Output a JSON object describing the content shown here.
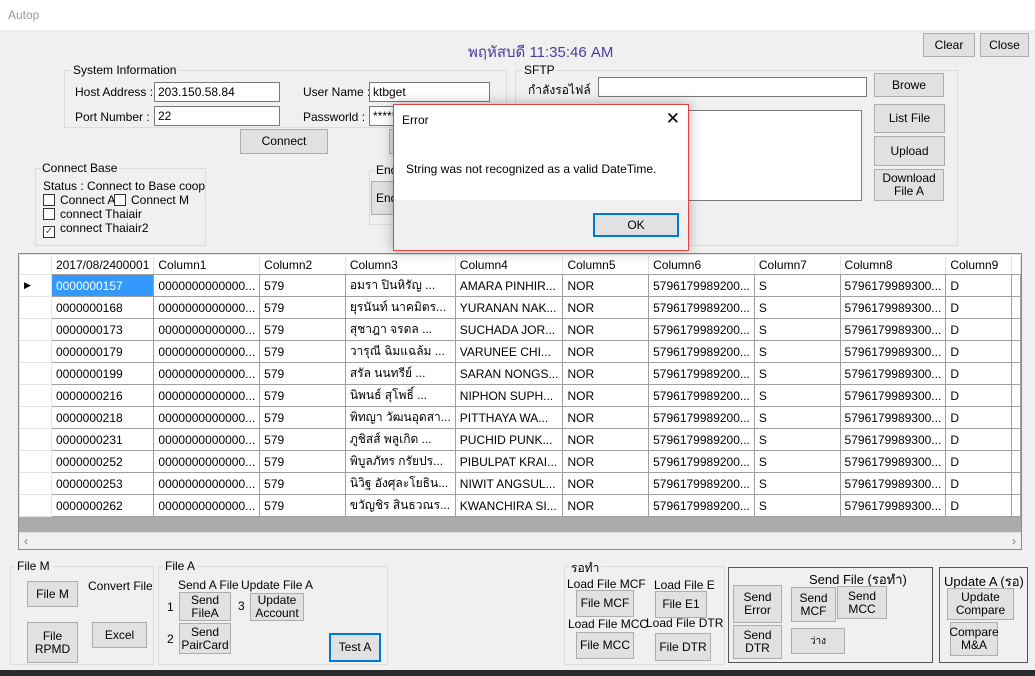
{
  "window": {
    "title": "Autop",
    "datetime": "พฤหัสบดี 11:35:46 AM",
    "clear": "Clear",
    "close": "Close"
  },
  "system_info": {
    "title": "System Information",
    "host_label": "Host Address :",
    "host_value": "203.150.58.84",
    "port_label": "Port Number :",
    "port_value": "22",
    "user_label": "User Name :",
    "user_value": "ktbget",
    "password_label": "Passworld :",
    "password_value": "******",
    "connect": "Connect"
  },
  "connect_base": {
    "title": "Connect Base",
    "status": "Status : Connect to Base coop_sa",
    "connect_a": "Connect A",
    "connect_m": "Connect M",
    "thaiair": "connect Thaiair",
    "thaiair2": "connect Thaiair2"
  },
  "end_group": {
    "title": "End",
    "button": "End"
  },
  "sftp": {
    "title": "SFTP",
    "waiting_label": "กำลังรอไฟล์",
    "waiting_value": "",
    "log_value": "",
    "browse": "Browe",
    "list": "List File",
    "upload": "Upload",
    "download": "Download File A"
  },
  "dialog": {
    "title": "Error",
    "message": "String was not recognized as a valid DateTime.",
    "ok": "OK"
  },
  "grid": {
    "columns": [
      "2017/08/2400001",
      "Column1",
      "Column2",
      "Column3",
      "Column4",
      "Column5",
      "Column6",
      "Column7",
      "Column8",
      "Column9"
    ],
    "rows": [
      [
        "0000000157",
        "0000000000000...",
        "579",
        "อมรา ปินหิรัญ    ...",
        "AMARA PINHIR...",
        "NOR",
        "5796179989200...",
        "S",
        "5796179989300...",
        "D"
      ],
      [
        "0000000168",
        "0000000000000...",
        "579",
        "ยุรนันท์ นาคมิตร...",
        "YURANAN NAK...",
        "NOR",
        "5796179989200...",
        "S",
        "5796179989300...",
        "D"
      ],
      [
        "0000000173",
        "0000000000000...",
        "579",
        "สุชาฎา จรดล     ...",
        "SUCHADA JOR...",
        "NOR",
        "5796179989200...",
        "S",
        "5796179989300...",
        "D"
      ],
      [
        "0000000179",
        "0000000000000...",
        "579",
        "วารุณี ฉิมแฉล้ม ...",
        "VARUNEE CHI...",
        "NOR",
        "5796179989200...",
        "S",
        "5796179989300...",
        "D"
      ],
      [
        "0000000199",
        "0000000000000...",
        "579",
        "สรัล นนทรีย์    ...",
        "SARAN NONGS...",
        "NOR",
        "5796179989200...",
        "S",
        "5796179989300...",
        "D"
      ],
      [
        "0000000216",
        "0000000000000...",
        "579",
        "นิพนธ์ สุโพธิ์   ...",
        "NIPHON SUPH...",
        "NOR",
        "5796179989200...",
        "S",
        "5796179989300...",
        "D"
      ],
      [
        "0000000218",
        "0000000000000...",
        "579",
        "พิทญา วัฒนอุดสา...",
        "PITTHAYA WA...",
        "NOR",
        "5796179989200...",
        "S",
        "5796179989300...",
        "D"
      ],
      [
        "0000000231",
        "0000000000000...",
        "579",
        "ภูชิสส์ พลูเกิด   ...",
        "PUCHID PUNK...",
        "NOR",
        "5796179989200...",
        "S",
        "5796179989300...",
        "D"
      ],
      [
        "0000000252",
        "0000000000000...",
        "579",
        "พิบูลภัทร กรัยปร...",
        "PIBULPAT KRAI...",
        "NOR",
        "5796179989200...",
        "S",
        "5796179989300...",
        "D"
      ],
      [
        "0000000253",
        "0000000000000...",
        "579",
        "นิวิฐ อังศุละโยธิน...",
        "NIWIT ANGSUL...",
        "NOR",
        "5796179989200...",
        "S",
        "5796179989300...",
        "D"
      ],
      [
        "0000000262",
        "0000000000000...",
        "579",
        "ขวัญชิร สินธวณร...",
        "KWANCHIRA SI...",
        "NOR",
        "5796179989200...",
        "S",
        "5796179989300...",
        "D"
      ]
    ]
  },
  "file_m": {
    "title": "File M",
    "file_m": "File M",
    "convert": "Convert File",
    "rpmd": "File RPMD",
    "excel": "Excel"
  },
  "file_a": {
    "title": "File A",
    "send_label": "Send A File",
    "update_label": "Update File A",
    "n1": "1",
    "n2": "2",
    "n3": "3",
    "send_filea": "Send FileA",
    "send_paircard": "Send PairCard",
    "update_account": "Update Account",
    "test_a": "Test A"
  },
  "pending": {
    "title": "รอทำ",
    "load_mcf": "Load File MCF",
    "load_e": "Load File E",
    "load_mcc": "Load File MCC",
    "load_dtr": "Load File DTR",
    "file_mcf": "File MCF",
    "file_e1": "File E1",
    "file_mcc": "File MCC",
    "file_dtr": "File DTR"
  },
  "send_file": {
    "title": "Send File (รอทำ)",
    "send_error": "Send Error",
    "send_mcf": "Send MCF",
    "send_mcc": "Send MCC",
    "send_dtr": "Send DTR",
    "empty": "ว่าง"
  },
  "update_a": {
    "title": "Update A (รอ)",
    "update_compare": "Update Compare",
    "compare_ma": "Compare M&A"
  }
}
